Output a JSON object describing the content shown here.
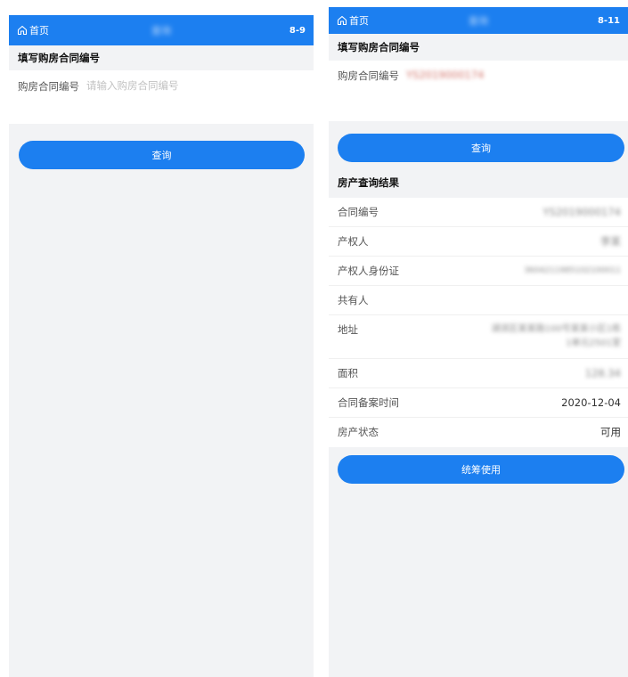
{
  "left": {
    "topbar": {
      "home_label": "首页",
      "title": "查询",
      "code": "8-9"
    },
    "section_title": "填写购房合同编号",
    "contract_field": {
      "label": "购房合同编号",
      "value": "",
      "placeholder": "请输入购房合同编号"
    },
    "query_button": "查询"
  },
  "right": {
    "topbar": {
      "home_label": "首页",
      "title": "查询",
      "code": "8-11"
    },
    "section_title": "填写购房合同编号",
    "contract_field": {
      "label": "购房合同编号",
      "value": "YS2019000174"
    },
    "query_button": "查询",
    "result_title": "房产查询结果",
    "results": [
      {
        "key": "合同编号",
        "value": "YS2019000174"
      },
      {
        "key": "产权人",
        "value": "李某"
      },
      {
        "key": "产权人身份证",
        "value": "3604211985102100011"
      },
      {
        "key": "共有人",
        "value": ""
      },
      {
        "key": "地址",
        "value": "湖滨区某某路100号某某小区1栋1单元2501室"
      },
      {
        "key": "面积",
        "value": "128.34"
      },
      {
        "key": "合同备案时间",
        "value": "2020-12-04"
      },
      {
        "key": "房产状态",
        "value": "可用"
      }
    ],
    "use_button": "统筹使用"
  },
  "colors": {
    "primary": "#1c7ff0",
    "background": "#f2f3f5"
  },
  "icons": {
    "home": "home-icon"
  }
}
